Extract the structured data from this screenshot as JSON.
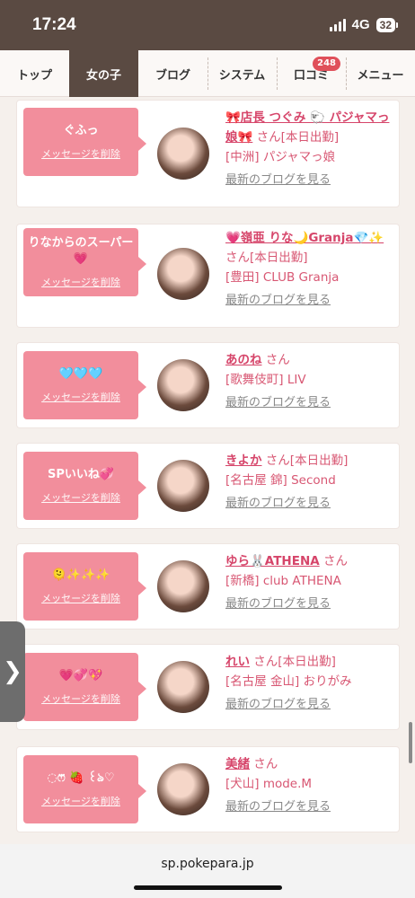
{
  "status": {
    "time": "17:24",
    "network": "4G",
    "battery": "32"
  },
  "nav": {
    "tabs": [
      {
        "label": "トップ",
        "active": false
      },
      {
        "label": "女の子",
        "active": true
      },
      {
        "label": "ブログ",
        "active": false
      },
      {
        "label": "システム",
        "active": false
      },
      {
        "label": "口コミ",
        "active": false,
        "badge": "248"
      },
      {
        "label": "メニュー",
        "active": false
      }
    ]
  },
  "cards": [
    {
      "message": "ぐふっ",
      "delete_label": "メッセージを削除",
      "name": "🎀店長 つぐみ 🐑 パジャマっ娘🎀",
      "suffix": "さん[本日出勤]",
      "area": "[中洲] パジャマっ娘",
      "blog_label": "最新のブログを見る"
    },
    {
      "message": "りなからのスーパー💗",
      "delete_label": "メッセージを削除",
      "name": "💗嶺亜 りな🌙Granja💎✨",
      "suffix": "さん[本日出勤]",
      "area": "[豊田] CLUB Granja",
      "blog_label": "最新のブログを見る"
    },
    {
      "message": "🩵🩵🩵",
      "delete_label": "メッセージを削除",
      "name": "あのね",
      "suffix": "さん",
      "area": "[歌舞伎町] LIV",
      "blog_label": "最新のブログを見る"
    },
    {
      "message": "SPいいね💞",
      "delete_label": "メッセージを削除",
      "name": "きよか",
      "suffix": "さん[本日出勤]",
      "area": "[名古屋 錦] Second",
      "blog_label": "最新のブログを見る"
    },
    {
      "message": "🫠✨✨✨",
      "delete_label": "メッセージを削除",
      "name": "ゆら🐰ATHENA",
      "suffix": "さん",
      "area": "[新橋] club ATHENA",
      "blog_label": "最新のブログを見る"
    },
    {
      "message": "💗💞💖",
      "delete_label": "メッセージを削除",
      "name": "れい",
      "suffix": "さん[本日出勤]",
      "area": "[名古屋 金山] おりがみ",
      "blog_label": "最新のブログを見る"
    },
    {
      "message": "◌ෆ⃛ 🍓 ꒰ঌ♡",
      "delete_label": "メッセージを削除",
      "name": "美緒",
      "suffix": "さん",
      "area": "[犬山] mode.M",
      "blog_label": "最新のブログを見る"
    }
  ],
  "side_tab": {
    "icon": "chevron-right-icon",
    "glyph": "❯"
  },
  "url": "sp.pokepara.jp",
  "colors": {
    "bubble": "#f28e9c",
    "name": "#d6456a",
    "nav_active": "#5a4a42",
    "badge": "#e0505a"
  }
}
